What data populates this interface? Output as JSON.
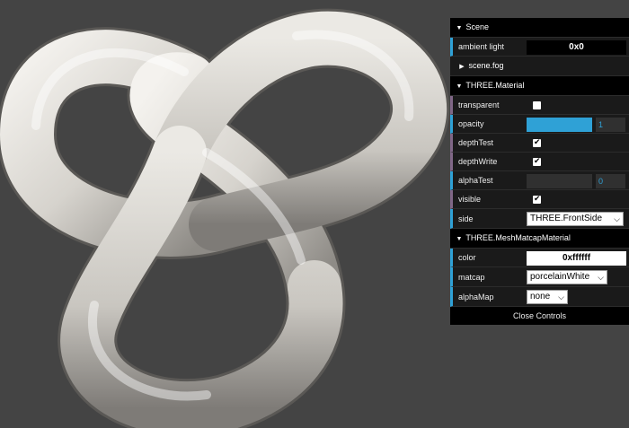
{
  "scene": {
    "title": "Scene",
    "ambient_light_label": "ambient light",
    "ambient_light_value": "0x0",
    "fog_title": "scene.fog"
  },
  "material": {
    "title": "THREE.Material",
    "transparent_label": "transparent",
    "transparent_checked": false,
    "opacity_label": "opacity",
    "opacity_value": "1",
    "opacity_fraction": 1,
    "depthTest_label": "depthTest",
    "depthTest_checked": true,
    "depthWrite_label": "depthWrite",
    "depthWrite_checked": true,
    "alphaTest_label": "alphaTest",
    "alphaTest_value": "0",
    "alphaTest_fraction": 0,
    "visible_label": "visible",
    "visible_checked": true,
    "side_label": "side",
    "side_value": "THREE.FrontSide"
  },
  "matcap_material": {
    "title": "THREE.MeshMatcapMaterial",
    "color_label": "color",
    "color_value": "0xffffff",
    "matcap_label": "matcap",
    "matcap_value": "porcelainWhite",
    "alphaMap_label": "alphaMap",
    "alphaMap_value": "none"
  },
  "close_label": "Close Controls",
  "colors": {
    "background": "#444444",
    "knot": "#d8d6d2",
    "accent": "#2fa1d6"
  },
  "icons": {
    "expanded": "triangle-down-icon",
    "collapsed": "triangle-right-icon",
    "check": "check-icon",
    "dropdown": "chevron-down-icon"
  }
}
